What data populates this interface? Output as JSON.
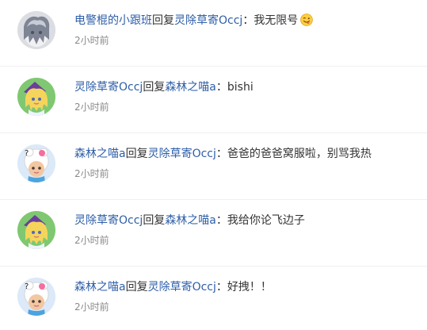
{
  "comments": [
    {
      "user": "电警棍的小跟班",
      "action": "回复",
      "reply_to": "灵除草寄Occj",
      "separator": "：",
      "message": "我无限号",
      "emoji": "winking-face-emoji",
      "time": "2小时前",
      "avatar": "avatar-white-hair-anime"
    },
    {
      "user": "灵除草寄Occj",
      "action": "回复",
      "reply_to": "森林之喵a",
      "separator": "：",
      "message": "bishi",
      "time": "2小时前",
      "avatar": "avatar-blonde-witch"
    },
    {
      "user": "森林之喵a",
      "action": "回复",
      "reply_to": "灵除草寄Occj",
      "separator": "：",
      "message": "爸爸的爸爸窝服啦，别骂我热",
      "time": "2小时前",
      "avatar": "avatar-hello-kitty-costume"
    },
    {
      "user": "灵除草寄Occj",
      "action": "回复",
      "reply_to": "森林之喵a",
      "separator": "：",
      "message": "我给你论飞边子",
      "time": "2小时前",
      "avatar": "avatar-blonde-witch"
    },
    {
      "user": "森林之喵a",
      "action": "回复",
      "reply_to": "灵除草寄Occj",
      "separator": "：",
      "message": "好拽！！",
      "time": "2小时前",
      "avatar": "avatar-hello-kitty-costume"
    }
  ],
  "colors": {
    "username": "#2d5ea8",
    "timestamp": "#8a8a8a",
    "divider": "#f0f0f0"
  }
}
